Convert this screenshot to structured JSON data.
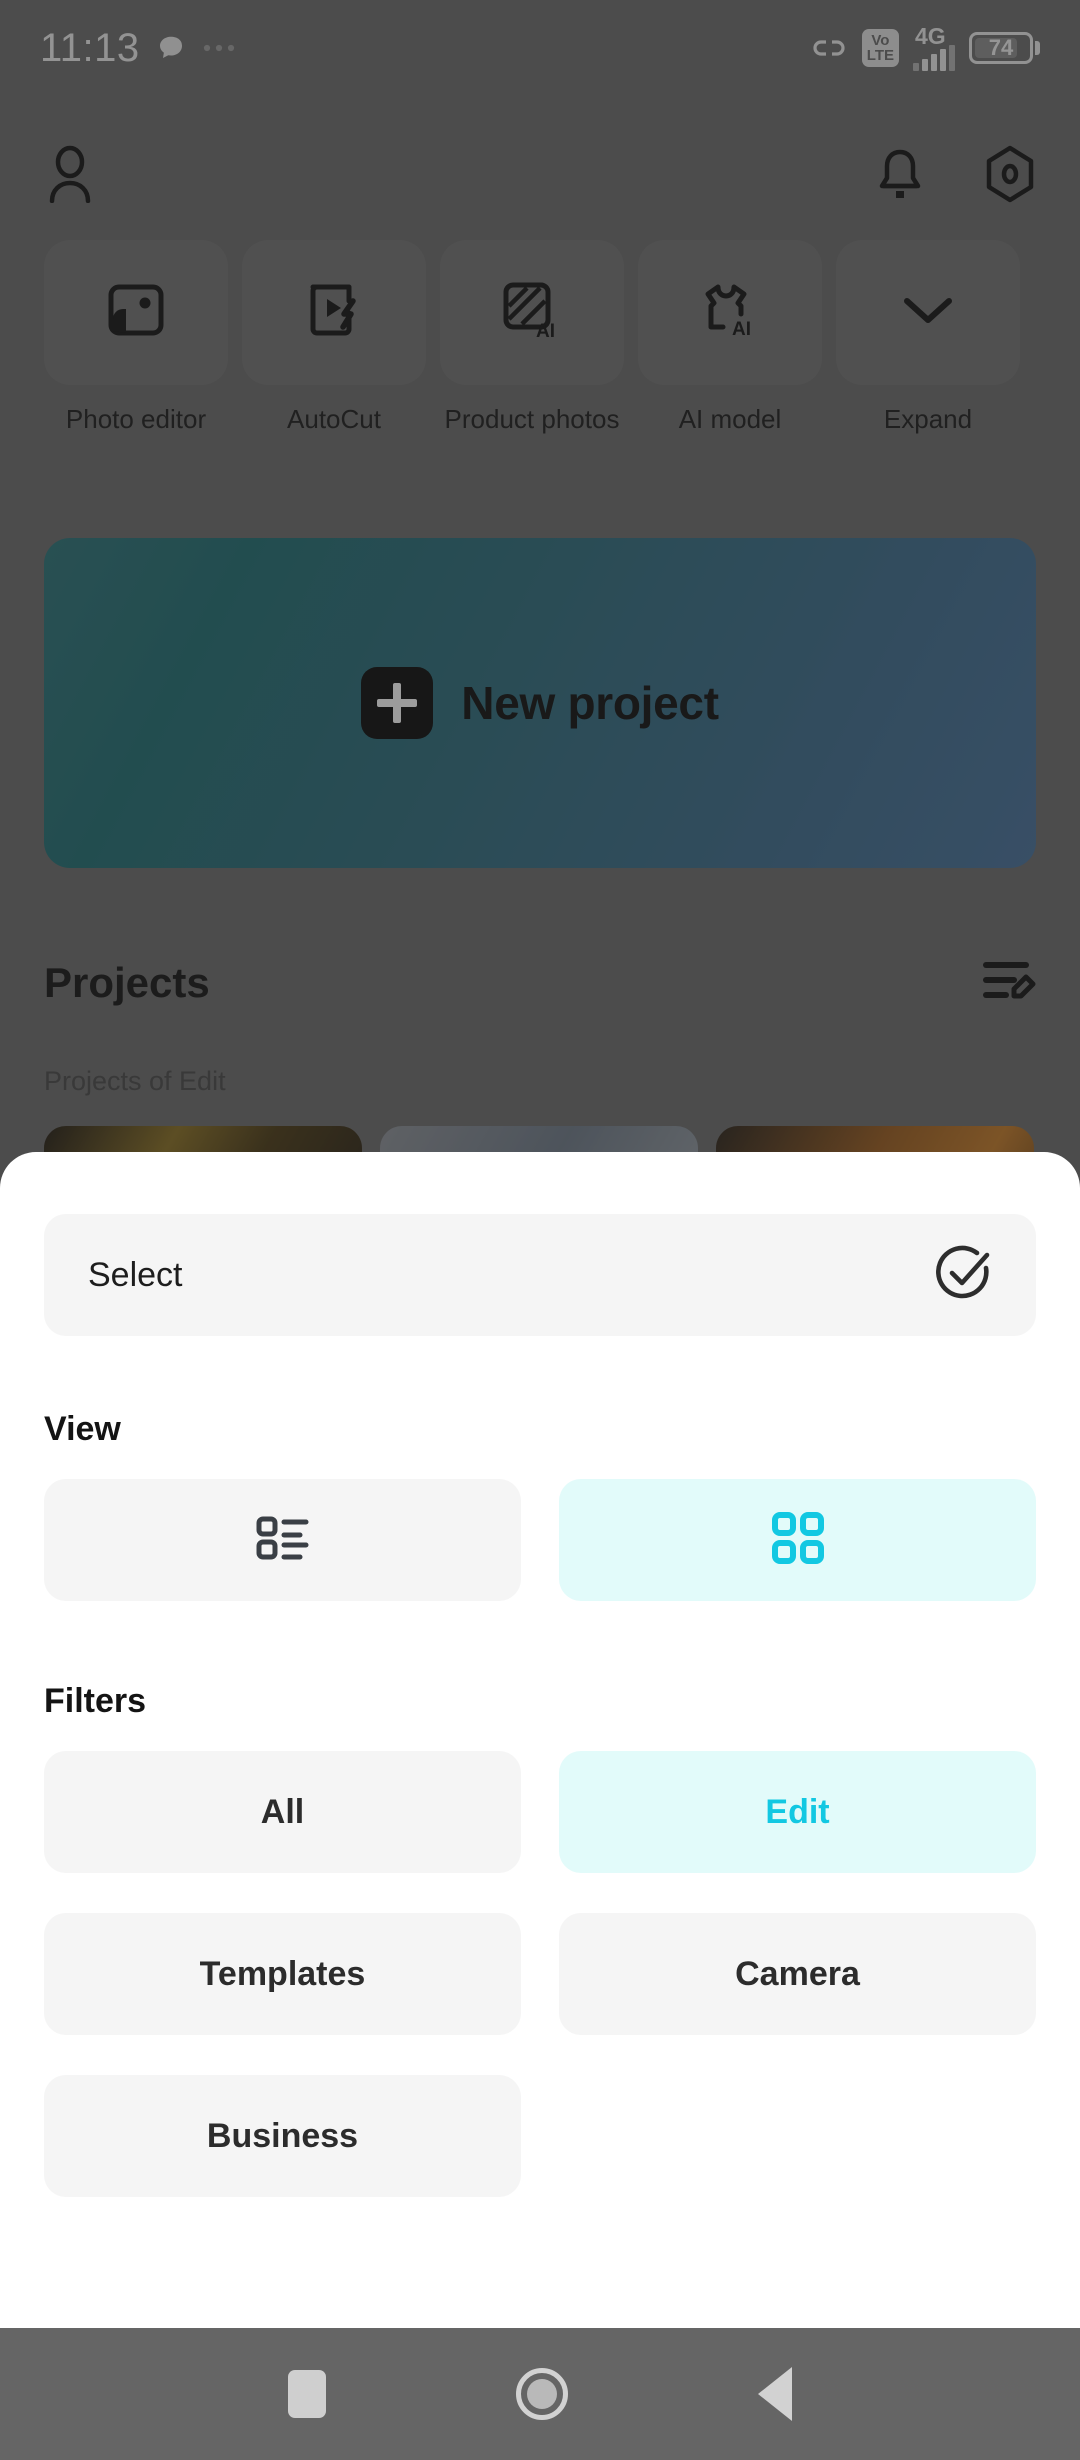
{
  "status_bar": {
    "time": "11:13",
    "left_icons": [
      "chat-bubble-icon",
      "more-dots-icon"
    ],
    "link_icon": "link-icon",
    "volte_top": "Vo",
    "volte_bottom": "LTE",
    "network": "4G",
    "battery_level": "74"
  },
  "app_header": {
    "profile_icon": "person-icon",
    "bell_icon": "bell-icon",
    "settings_icon": "settings-icon"
  },
  "tools": [
    {
      "label": "Photo editor",
      "icon": "photo-editor-icon"
    },
    {
      "label": "AutoCut",
      "icon": "autocut-icon"
    },
    {
      "label": "Product photos",
      "icon": "product-photos-ai-icon"
    },
    {
      "label": "AI model",
      "icon": "ai-model-shirt-icon"
    },
    {
      "label": "Expand",
      "icon": "chevron-down-icon"
    }
  ],
  "banner": {
    "label": "New project",
    "icon": "plus-square-icon",
    "gradient_from": "#2b7378",
    "gradient_to": "#47719b"
  },
  "projects": {
    "title": "Projects",
    "subtitle": "Projects of Edit",
    "edit_icon": "list-edit-icon",
    "thumbnails": [
      {
        "color": "#6d5a2b"
      },
      {
        "color": "#7b8592"
      },
      {
        "color": "#8a5426"
      }
    ]
  },
  "sheet": {
    "select": {
      "label": "Select",
      "icon": "circle-check-icon"
    },
    "view": {
      "title": "View",
      "options": [
        {
          "id": "list",
          "icon": "list-view-icon",
          "active": false
        },
        {
          "id": "grid",
          "icon": "grid-view-icon",
          "active": true
        }
      ]
    },
    "filters": {
      "title": "Filters",
      "options": [
        {
          "label": "All",
          "active": false
        },
        {
          "label": "Edit",
          "active": true
        },
        {
          "label": "Templates",
          "active": false
        },
        {
          "label": "Camera",
          "active": false
        },
        {
          "label": "Business",
          "active": false
        }
      ]
    }
  },
  "nav_bar": {
    "recents_icon": "square-recents-icon",
    "home_icon": "circle-home-icon",
    "back_icon": "triangle-back-icon"
  },
  "colors": {
    "accent": "#12c8e2",
    "accent_bg": "#e2fbfa",
    "sheet_bg": "#ffffff",
    "option_bg": "#f5f5f5"
  }
}
